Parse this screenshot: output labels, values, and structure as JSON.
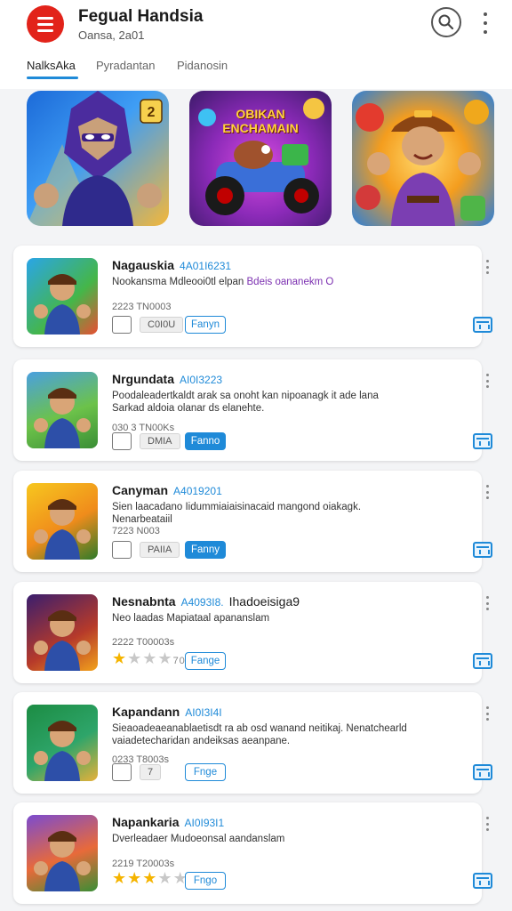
{
  "header": {
    "title": "Fegual Handsia",
    "subtitle": "Oansa, 2a01"
  },
  "tabs": [
    {
      "label": "NalksAka"
    },
    {
      "label": "Pyradantan"
    },
    {
      "label": "Pidanosin"
    }
  ],
  "featured": [
    {
      "name": "hero-banner",
      "badge": "2"
    },
    {
      "name": "racing-banner",
      "title": "OBIKAN ENCHAMAIN"
    },
    {
      "name": "adventure-banner"
    }
  ],
  "cards": [
    {
      "title": "Nagauskia",
      "id": "4A01I6231",
      "extra": "",
      "desc": "Nookansma Mdleooi0tl elpan",
      "desc_hl": "Bdeis oananekm O",
      "desc2": "",
      "meta": "2223  TN0003",
      "pill": "C0I0U",
      "button": "Fanyn",
      "button_style": "outline",
      "rating": null
    },
    {
      "title": "Nrgundata",
      "id": "AI0I3223",
      "extra": "",
      "desc": "Poodaleadertkaldt arak sa onoht kan nipoanagk it ade lana",
      "desc_hl": "",
      "desc2": "Sarkad aldoia olanar ds elanehte.",
      "meta": "030 3 TN00Ks",
      "pill": "DMIA",
      "button": "Fanno",
      "button_style": "filled",
      "rating": null
    },
    {
      "title": "Canyman",
      "id": "A4019201",
      "extra": "",
      "desc": "Sien laacadano Iidummiaiaisinacaid mangond oiakagk. Nenarbeataiil",
      "desc_hl": "",
      "desc2": "",
      "meta": "7223  N003",
      "pill": "PAIIA",
      "button": "Fanny",
      "button_style": "filled",
      "rating": null
    },
    {
      "title": "Nesnabnta",
      "id": "A4093I8.",
      "extra": "Ihadoeisiga9",
      "desc": "Neo laadas Mapiataal apananslam",
      "desc_hl": "",
      "desc2": "",
      "meta": "2222  T00003s",
      "pill": "",
      "button": "Fange",
      "button_style": "outline",
      "rating": {
        "value": 1,
        "max": 3,
        "text": "70"
      }
    },
    {
      "title": "Kapandann",
      "id": "AI0I3I4I",
      "extra": "",
      "desc": "Sieaoadeaeanablaetisdt ra ab osd wanand neitikaj. Nenatchearld",
      "desc_hl": "",
      "desc2": "vaiadetecharidan andeiksas aeanpane.",
      "meta": "0233  T8003s",
      "pill": "7",
      "button": "Fnge",
      "button_style": "outline",
      "rating": null
    },
    {
      "title": "Napankaria",
      "id": "AI0I93I1",
      "extra": "",
      "desc": "Dverleadaer Mudoeonsal aandanslam",
      "desc_hl": "",
      "desc2": "",
      "meta": "2219  T20003s",
      "pill": "",
      "button": "Fngo",
      "button_style": "outline",
      "rating": {
        "value": 3,
        "max": 4,
        "text": ""
      }
    }
  ],
  "colors": {
    "accent": "#1f8ad8",
    "brand_red": "#e2231a",
    "star": "#f5b400"
  }
}
